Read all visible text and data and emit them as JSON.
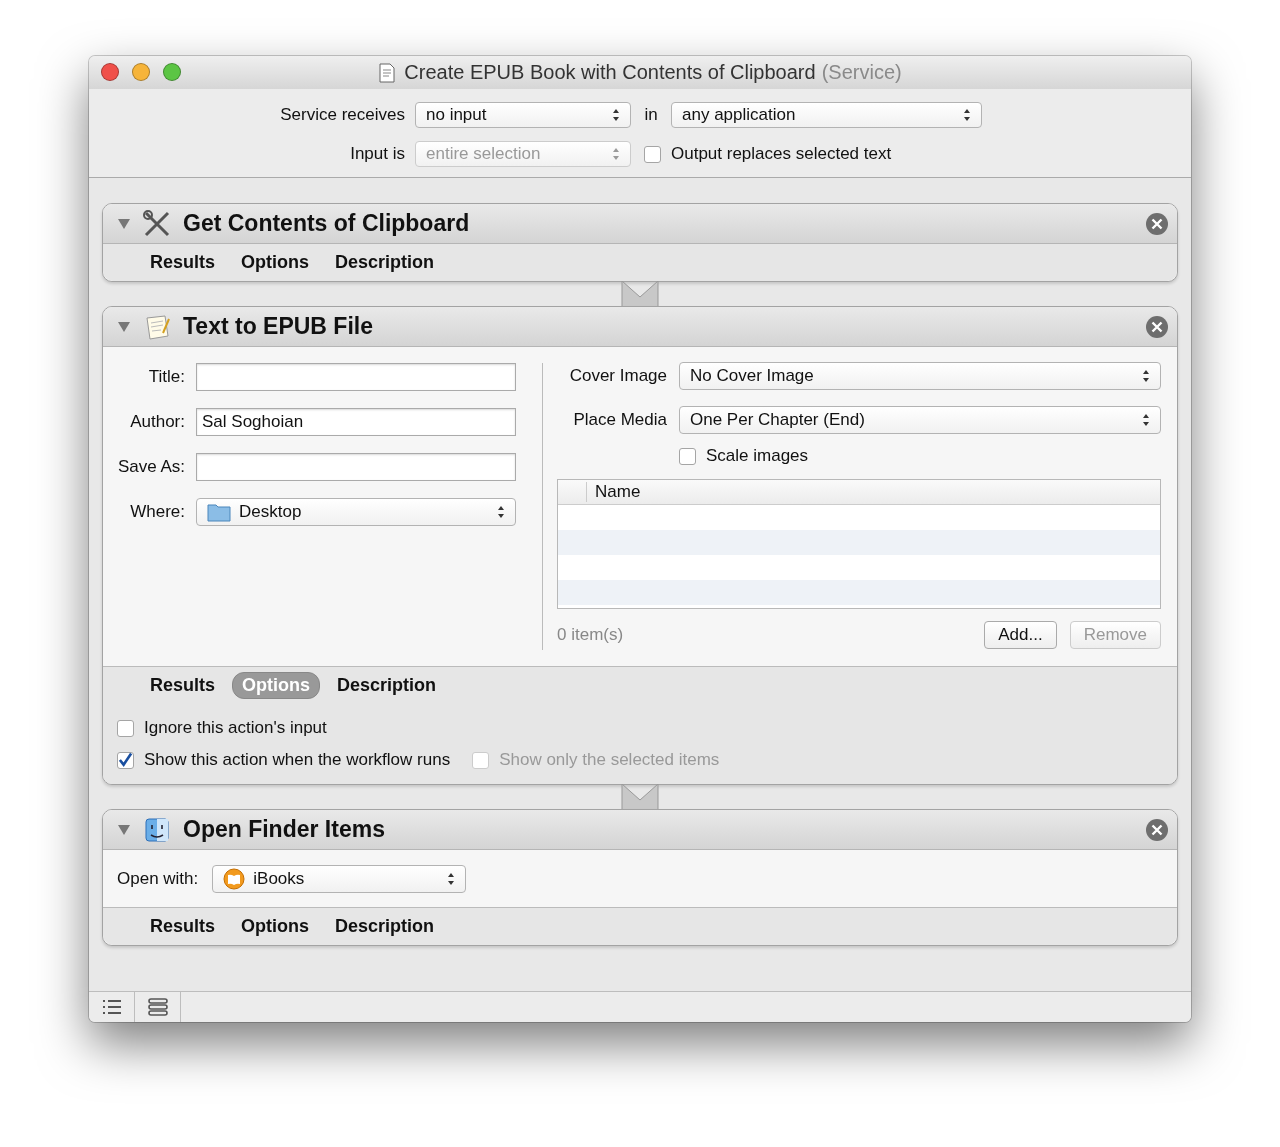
{
  "window": {
    "title": "Create EPUB Book with Contents of Clipboard",
    "title_suffix": "(Service)"
  },
  "service": {
    "receives_label": "Service receives",
    "receives_value": "no input",
    "in_label": "in",
    "in_value": "any application",
    "input_label": "Input is",
    "input_value": "entire selection",
    "input_disabled": true,
    "output_label": "Output replaces selected text",
    "output_checked": false
  },
  "actions": [
    {
      "kind": "clipboard",
      "title": "Get Contents of Clipboard",
      "tabs": [
        {
          "label": "Results",
          "selected": false
        },
        {
          "label": "Options",
          "selected": false
        },
        {
          "label": "Description",
          "selected": false
        }
      ]
    },
    {
      "kind": "epub",
      "title": "Text to EPUB File",
      "fields": [
        {
          "label": "Title:"
        },
        {
          "label": "Author:",
          "value": "Sal Soghoian"
        },
        {
          "label": "Save As:"
        }
      ],
      "where": {
        "label": "Where:",
        "value": "Desktop"
      },
      "cover": {
        "label": "Cover Image",
        "value": "No Cover Image"
      },
      "media": {
        "label": "Place Media",
        "value": "One Per Chapter (End)"
      },
      "scale": {
        "label": "Scale images",
        "checked": false
      },
      "table": {
        "columns": [
          "Name"
        ]
      },
      "count": "0 item(s)",
      "buttons": [
        {
          "label": "Add...",
          "disabled": false
        },
        {
          "label": "Remove",
          "disabled": true
        }
      ],
      "tabs": [
        {
          "label": "Results",
          "selected": false
        },
        {
          "label": "Options",
          "selected": true
        },
        {
          "label": "Description",
          "selected": false
        }
      ],
      "options": [
        {
          "label": "Ignore this action's input",
          "checked": false,
          "disabled": false
        },
        {
          "label": "Show this action when the workflow runs",
          "checked": true,
          "disabled": false
        },
        {
          "label": "Show only the selected items",
          "checked": false,
          "disabled": true
        }
      ]
    },
    {
      "kind": "finder",
      "title": "Open Finder Items",
      "open_with": {
        "label": "Open with:",
        "value": "iBooks"
      },
      "tabs": [
        {
          "label": "Results",
          "selected": false
        },
        {
          "label": "Options",
          "selected": false
        },
        {
          "label": "Description",
          "selected": false
        }
      ]
    }
  ]
}
